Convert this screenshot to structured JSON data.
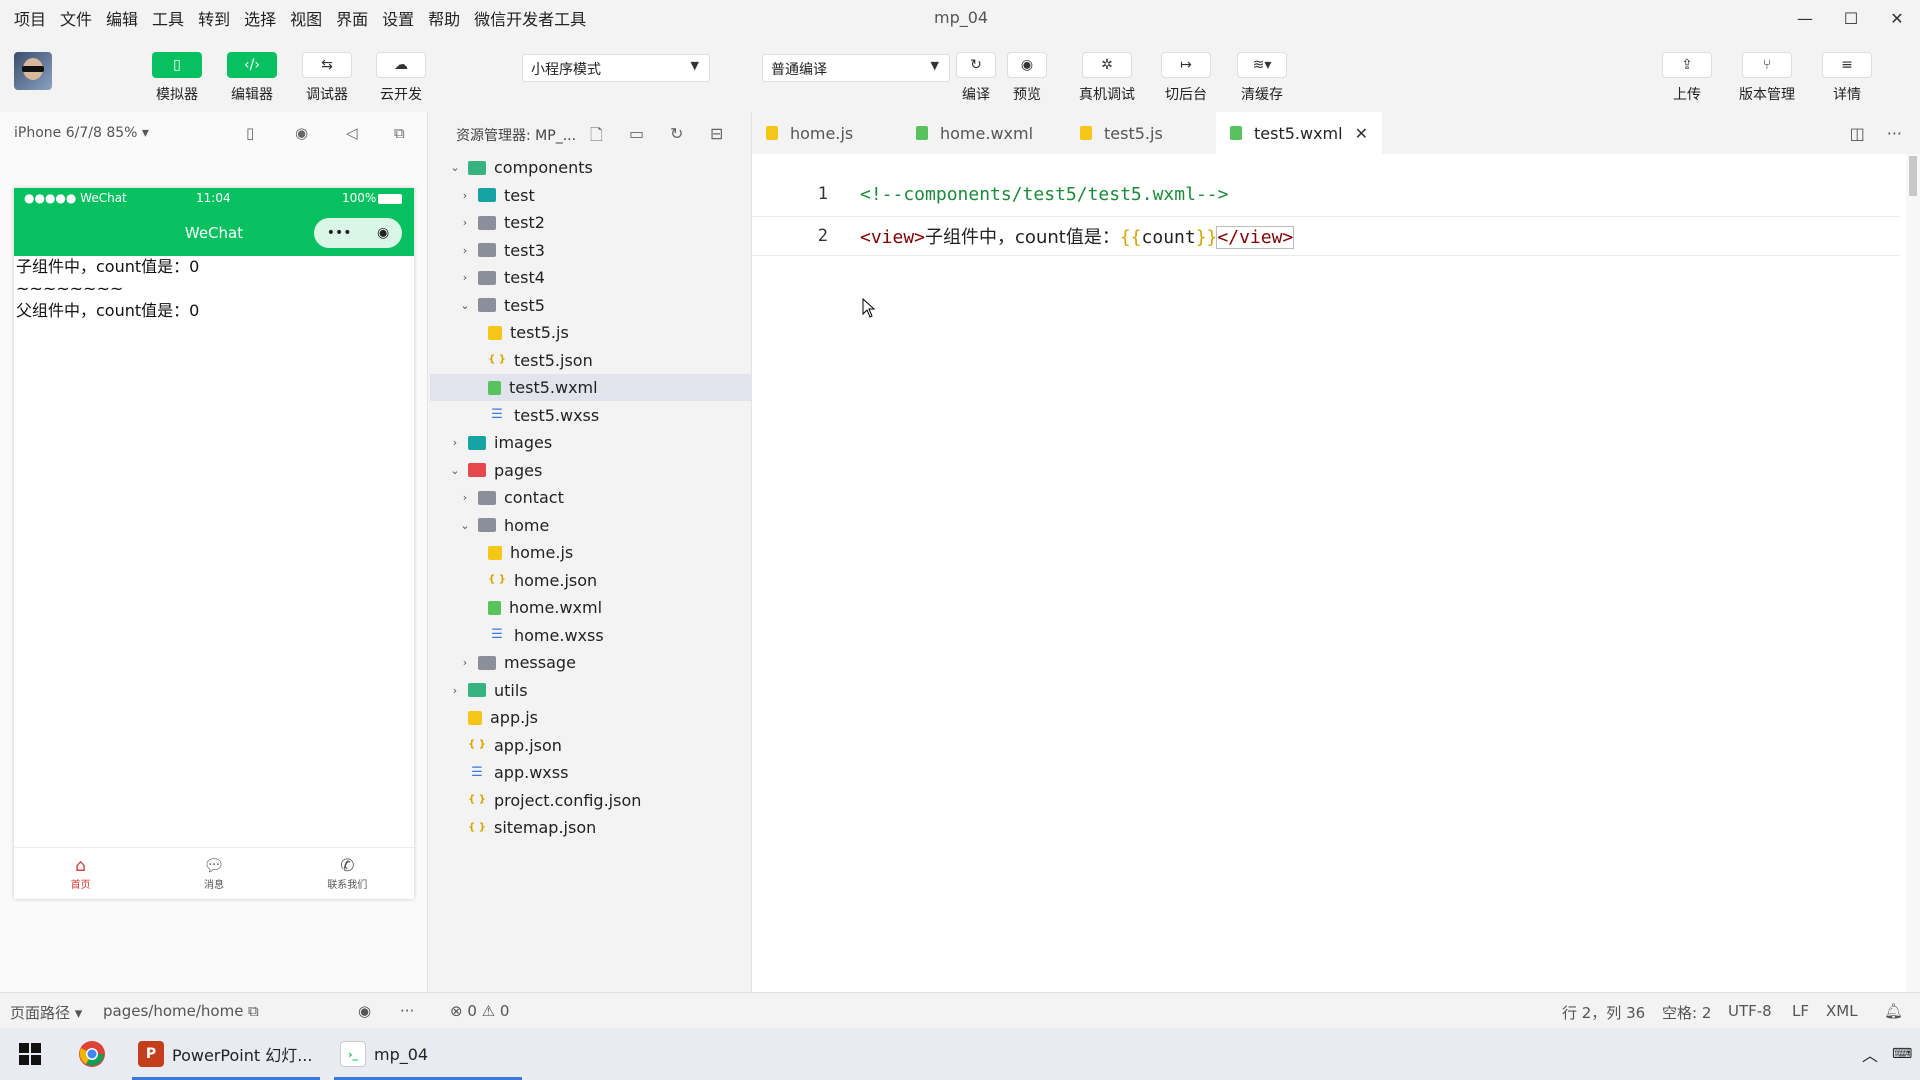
{
  "window": {
    "title": "mp_04"
  },
  "menu": [
    "项目",
    "文件",
    "编辑",
    "工具",
    "转到",
    "选择",
    "视图",
    "界面",
    "设置",
    "帮助",
    "微信开发者工具"
  ],
  "toolbar": {
    "simulator_label": "模拟器",
    "editor_label": "编辑器",
    "debugger_label": "调试器",
    "cloud_label": "云开发",
    "mode_select": "小程序模式",
    "compile_select": "普通编译",
    "compile_label": "编译",
    "preview_label": "预览",
    "remote_debug_label": "真机调试",
    "background_label": "切后台",
    "clear_cache_label": "清缓存",
    "upload_label": "上传",
    "version_label": "版本管理",
    "details_label": "详情"
  },
  "simulator": {
    "device": "iPhone 6/7/8 85% ▾",
    "status_signal": "●●●●● WeChat",
    "status_time": "11:04",
    "status_battery": "100%",
    "nav_title": "WeChat",
    "lines": [
      "子组件中，count值是：0",
      "~~~~~~~~",
      "父组件中，count值是：0"
    ],
    "tabbar": [
      {
        "label": "首页",
        "icon": "home-icon"
      },
      {
        "label": "消息",
        "icon": "message-icon"
      },
      {
        "label": "联系我们",
        "icon": "phone-icon"
      }
    ]
  },
  "explorer": {
    "title": "资源管理器: MP_...",
    "tree": [
      {
        "label": "components",
        "depth": 0,
        "type": "folder-green",
        "chev": "open"
      },
      {
        "label": "test",
        "depth": 1,
        "type": "folder-teal",
        "chev": "closed"
      },
      {
        "label": "test2",
        "depth": 1,
        "type": "folder",
        "chev": "closed"
      },
      {
        "label": "test3",
        "depth": 1,
        "type": "folder",
        "chev": "closed"
      },
      {
        "label": "test4",
        "depth": 1,
        "type": "folder",
        "chev": "closed"
      },
      {
        "label": "test5",
        "depth": 1,
        "type": "folder",
        "chev": "open"
      },
      {
        "label": "test5.js",
        "depth": 2,
        "type": "js",
        "chev": ""
      },
      {
        "label": "test5.json",
        "depth": 2,
        "type": "json",
        "chev": ""
      },
      {
        "label": "test5.wxml",
        "depth": 2,
        "type": "wxml",
        "chev": "",
        "selected": true
      },
      {
        "label": "test5.wxss",
        "depth": 2,
        "type": "wxss",
        "chev": ""
      },
      {
        "label": "images",
        "depth": 0,
        "type": "folder-teal",
        "chev": "closed"
      },
      {
        "label": "pages",
        "depth": 0,
        "type": "folder-red",
        "chev": "open"
      },
      {
        "label": "contact",
        "depth": 1,
        "type": "folder",
        "chev": "closed"
      },
      {
        "label": "home",
        "depth": 1,
        "type": "folder",
        "chev": "open"
      },
      {
        "label": "home.js",
        "depth": 2,
        "type": "js",
        "chev": ""
      },
      {
        "label": "home.json",
        "depth": 2,
        "type": "json",
        "chev": ""
      },
      {
        "label": "home.wxml",
        "depth": 2,
        "type": "wxml",
        "chev": ""
      },
      {
        "label": "home.wxss",
        "depth": 2,
        "type": "wxss",
        "chev": ""
      },
      {
        "label": "message",
        "depth": 1,
        "type": "folder",
        "chev": "closed"
      },
      {
        "label": "utils",
        "depth": 0,
        "type": "folder-green",
        "chev": "closed"
      },
      {
        "label": "app.js",
        "depth": 0,
        "type": "js",
        "chev": ""
      },
      {
        "label": "app.json",
        "depth": 0,
        "type": "json",
        "chev": ""
      },
      {
        "label": "app.wxss",
        "depth": 0,
        "type": "wxss",
        "chev": ""
      },
      {
        "label": "project.config.json",
        "depth": 0,
        "type": "json",
        "chev": ""
      },
      {
        "label": "sitemap.json",
        "depth": 0,
        "type": "json",
        "chev": ""
      }
    ]
  },
  "editor": {
    "tabs": [
      {
        "label": "home.js",
        "type": "js",
        "active": false
      },
      {
        "label": "home.wxml",
        "type": "wxml",
        "active": false
      },
      {
        "label": "test5.js",
        "type": "js",
        "active": false
      },
      {
        "label": "test5.wxml",
        "type": "wxml",
        "active": true
      }
    ],
    "lines": [
      {
        "number": "1",
        "comment": "<!--components/test5/test5.wxml-->"
      },
      {
        "number": "2",
        "open_tag": "<view>",
        "text": "子组件中，count值是：",
        "brace_open": "{{",
        "var": "count",
        "brace_close": "}}",
        "close_tag": "</view>"
      }
    ]
  },
  "statusbar": {
    "page_path_label": "页面路径 ▾",
    "page_path": "pages/home/home",
    "errors": "⊗ 0 ⚠ 0",
    "position": "行 2，列 36",
    "spaces": "空格: 2",
    "encoding": "UTF-8",
    "eol": "LF",
    "language": "XML"
  },
  "taskbar": {
    "items": [
      {
        "label": "PowerPoint 幻灯...",
        "icon": "powerpoint-icon"
      },
      {
        "label": "mp_04",
        "icon": "wechat-devtools-icon"
      }
    ]
  },
  "colors": {
    "accent_green": "#07c160",
    "tabbar_active": "#d43c33",
    "selection": "#e1e4ec"
  }
}
